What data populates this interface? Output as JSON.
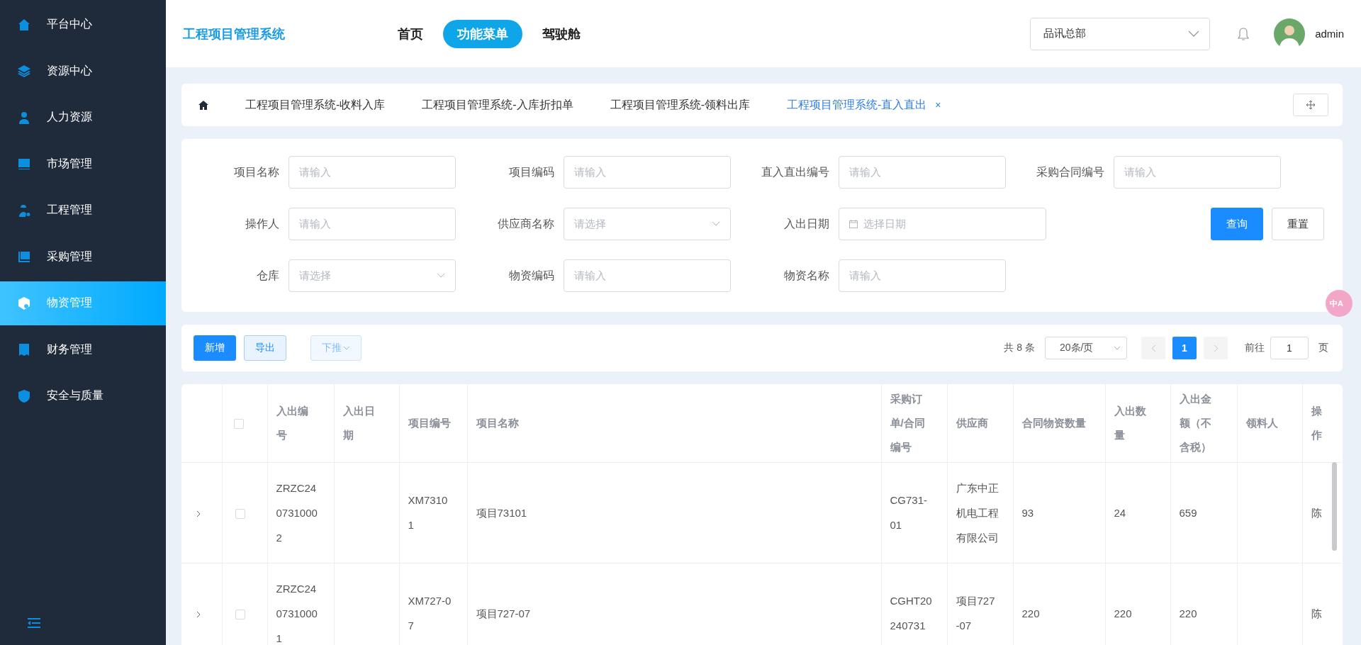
{
  "sidebar": {
    "items": [
      {
        "label": "平台中心",
        "selected": false
      },
      {
        "label": "资源中心",
        "selected": false
      },
      {
        "label": "人力资源",
        "selected": false
      },
      {
        "label": "市场管理",
        "selected": false
      },
      {
        "label": "工程管理",
        "selected": false
      },
      {
        "label": "采购管理",
        "selected": false
      },
      {
        "label": "物资管理",
        "selected": true
      },
      {
        "label": "财务管理",
        "selected": false
      },
      {
        "label": "安全与质量",
        "selected": false
      }
    ]
  },
  "header": {
    "title": "工程项目管理系统",
    "nav": [
      {
        "label": "首页",
        "selected": false
      },
      {
        "label": "功能菜单",
        "selected": true
      },
      {
        "label": "驾驶舱",
        "selected": false
      }
    ],
    "org_select": {
      "value": "品讯总部"
    },
    "user": {
      "name": "admin"
    }
  },
  "tabs": [
    {
      "label": "工程项目管理系统-收料入库",
      "selected": false
    },
    {
      "label": "工程项目管理系统-入库折扣单",
      "selected": false
    },
    {
      "label": "工程项目管理系统-领料出库",
      "selected": false
    },
    {
      "label": "工程项目管理系统-直入直出",
      "selected": true,
      "close": "×"
    }
  ],
  "filters": {
    "rows": [
      [
        {
          "label": "项目名称",
          "kind": "input",
          "placeholder": "请输入"
        },
        {
          "label": "项目编码",
          "kind": "input",
          "placeholder": "请输入"
        },
        {
          "label": "直入直出编号",
          "kind": "input",
          "placeholder": "请输入"
        },
        {
          "label": "采购合同编号",
          "kind": "input",
          "placeholder": "请输入"
        }
      ],
      [
        {
          "label": "操作人",
          "kind": "input",
          "placeholder": "请输入"
        },
        {
          "label": "供应商名称",
          "kind": "select",
          "placeholder": "请选择"
        },
        {
          "label": "入出日期",
          "kind": "date",
          "placeholder": "选择日期"
        }
      ],
      [
        {
          "label": "仓库",
          "kind": "select",
          "placeholder": "请选择"
        },
        {
          "label": "物资编码",
          "kind": "input",
          "placeholder": "请输入"
        },
        {
          "label": "物资名称",
          "kind": "input",
          "placeholder": "请输入"
        }
      ]
    ],
    "buttons": [
      {
        "label": "查询",
        "kind": "primary"
      },
      {
        "label": "重置",
        "kind": "plain"
      }
    ]
  },
  "toolbar": {
    "buttons": [
      {
        "label": "新增",
        "kind": "primary"
      },
      {
        "label": "导出",
        "kind": "light"
      },
      {
        "label": "下推",
        "kind": "dropdown",
        "disabled": true
      }
    ],
    "pagination": {
      "total": "共 8 条",
      "page_size": "20条/页",
      "pages": [
        {
          "label": "1",
          "selected": true
        }
      ],
      "goto_label": "前往",
      "goto_value": "1",
      "unit": "页"
    }
  },
  "translate_badge": "中A",
  "table": {
    "header_checked": false,
    "columns": [
      "入出编号",
      "入出日期",
      "项目编号",
      "项目名称",
      "采购订单/合同编号",
      "供应商",
      "合同物资数量",
      "入出数量",
      "入出金额（不含税）",
      "领料人",
      "操作"
    ],
    "rows": [
      {
        "expanded": false,
        "checked": false,
        "cells": [
          "ZRZC2407310002",
          "",
          "XM73101",
          "项目73101",
          "CG731-01",
          "广东中正机电工程有限公司",
          "93",
          "24",
          "659",
          "",
          "陈"
        ]
      },
      {
        "expanded": false,
        "checked": false,
        "cells": [
          "ZRZC2407310001",
          "",
          "XM727-07",
          "项目727-07",
          "CGHT20240731",
          "项目727-07",
          "220",
          "220",
          "220",
          "",
          "陈"
        ]
      }
    ]
  }
}
